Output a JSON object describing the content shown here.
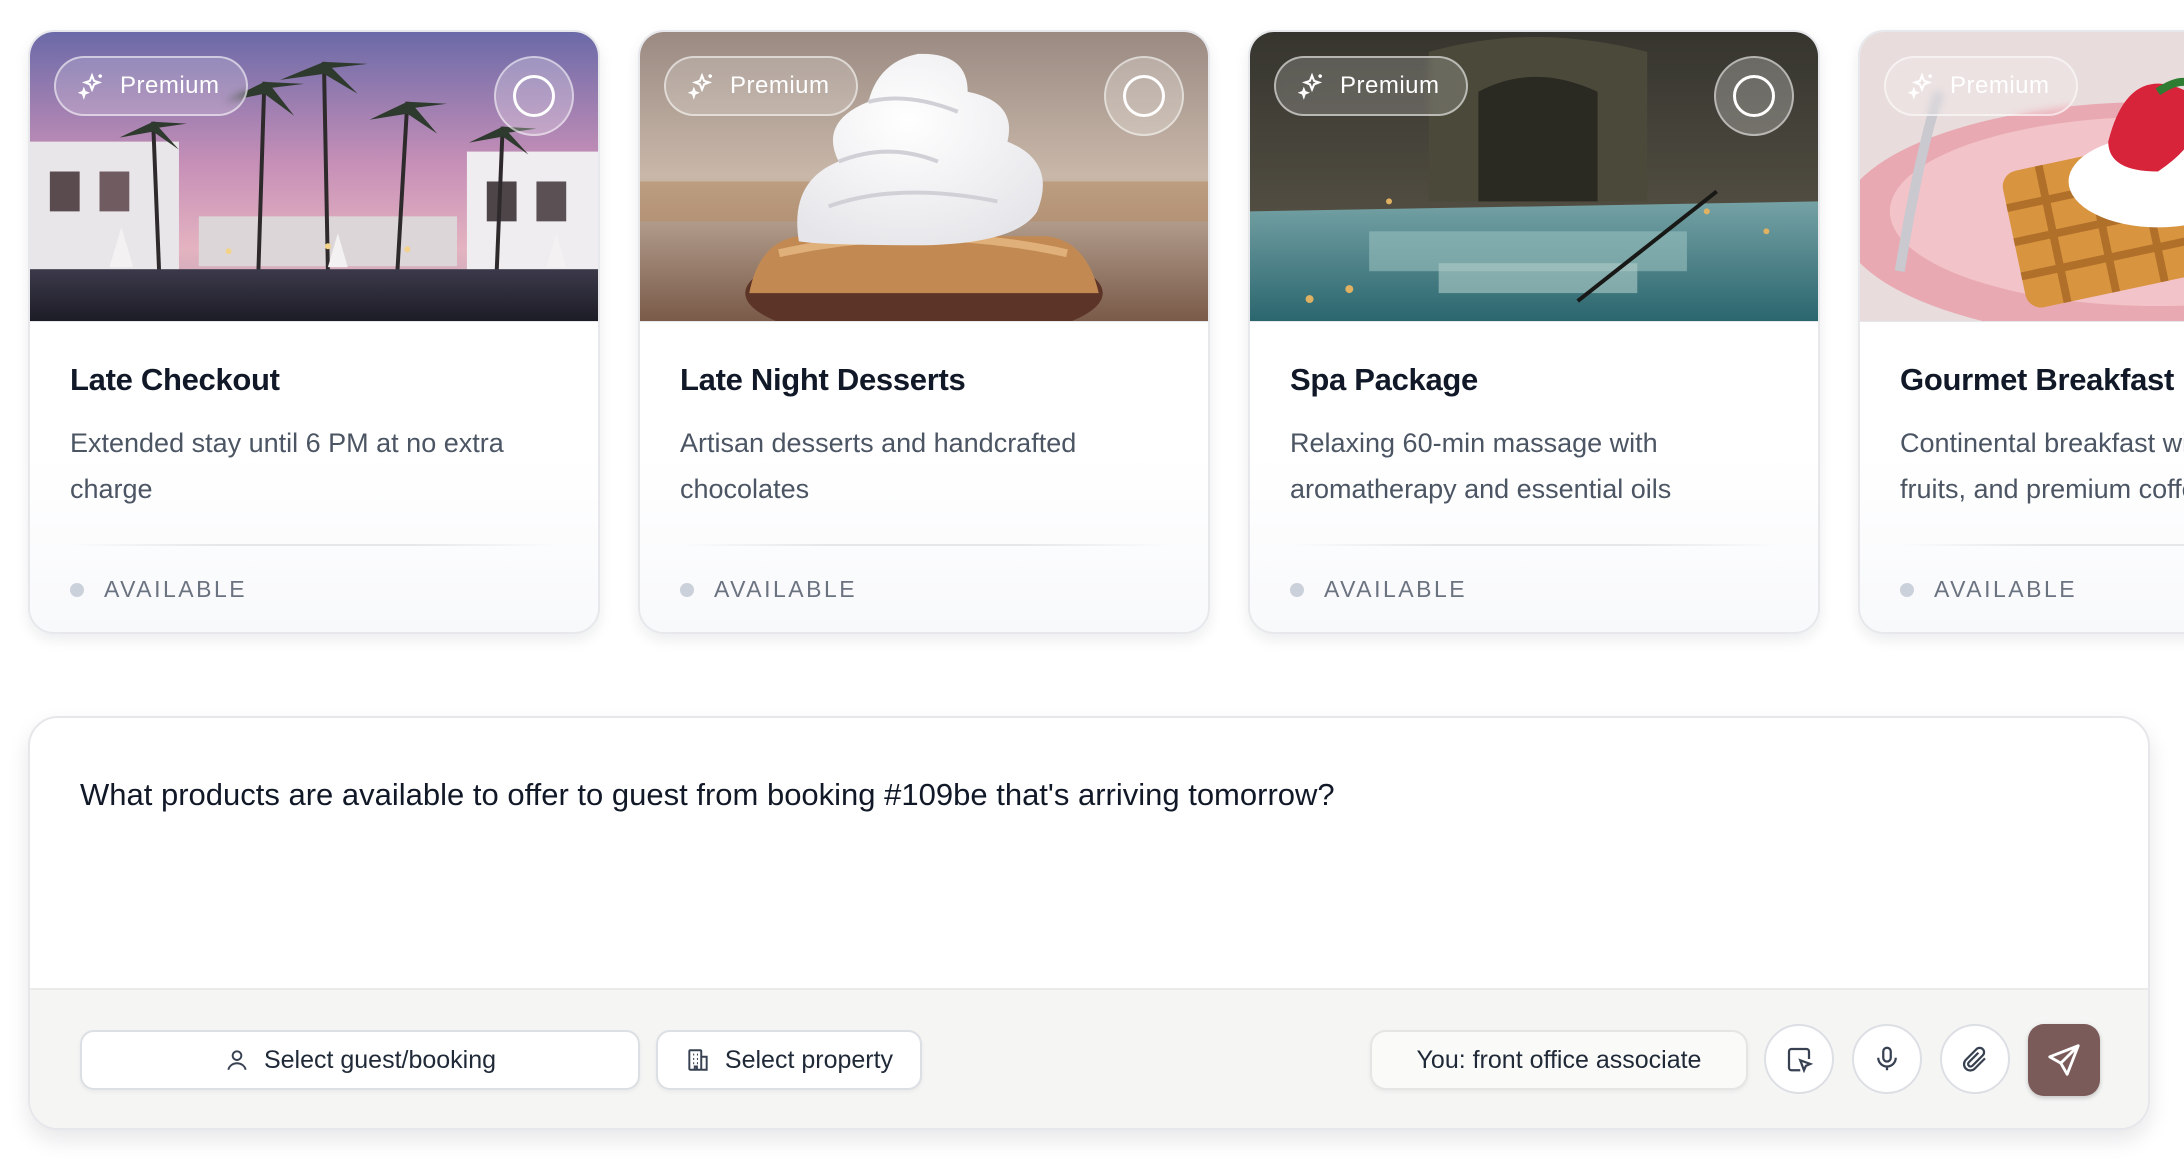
{
  "products": [
    {
      "badge": "Premium",
      "title": "Late Checkout",
      "description": "Extended stay until 6 PM at no extra charge",
      "status": "AVAILABLE",
      "image_icon": "resort-pool-palms"
    },
    {
      "badge": "Premium",
      "title": "Late Night Desserts",
      "description": "Artisan desserts and handcrafted chocolates",
      "status": "AVAILABLE",
      "image_icon": "whipped-cream-cupcake"
    },
    {
      "badge": "Premium",
      "title": "Spa Package",
      "description": "Relaxing 60-min massage with aromatherapy and essential oils",
      "status": "AVAILABLE",
      "image_icon": "spa-thermal-pool"
    },
    {
      "badge": "Premium",
      "title": "Gourmet Breakfast",
      "description": "Continental breakfast with pastries, fruits, and premium coffee",
      "status": "AVAILABLE",
      "image_icon": "waffle-strawberry"
    }
  ],
  "composer": {
    "message": "What products are available to offer to guest from booking #109be that's arriving tomorrow?",
    "guest_selector": "Select guest/booking",
    "property_selector": "Select property",
    "role": "You: front office associate",
    "icons": {
      "guest": "user-icon",
      "property": "building-icon",
      "pointer": "cursor-select-icon",
      "mic": "microphone-icon",
      "attach": "paperclip-icon",
      "send": "send-icon"
    },
    "accent_color": "#7b5a5a"
  }
}
